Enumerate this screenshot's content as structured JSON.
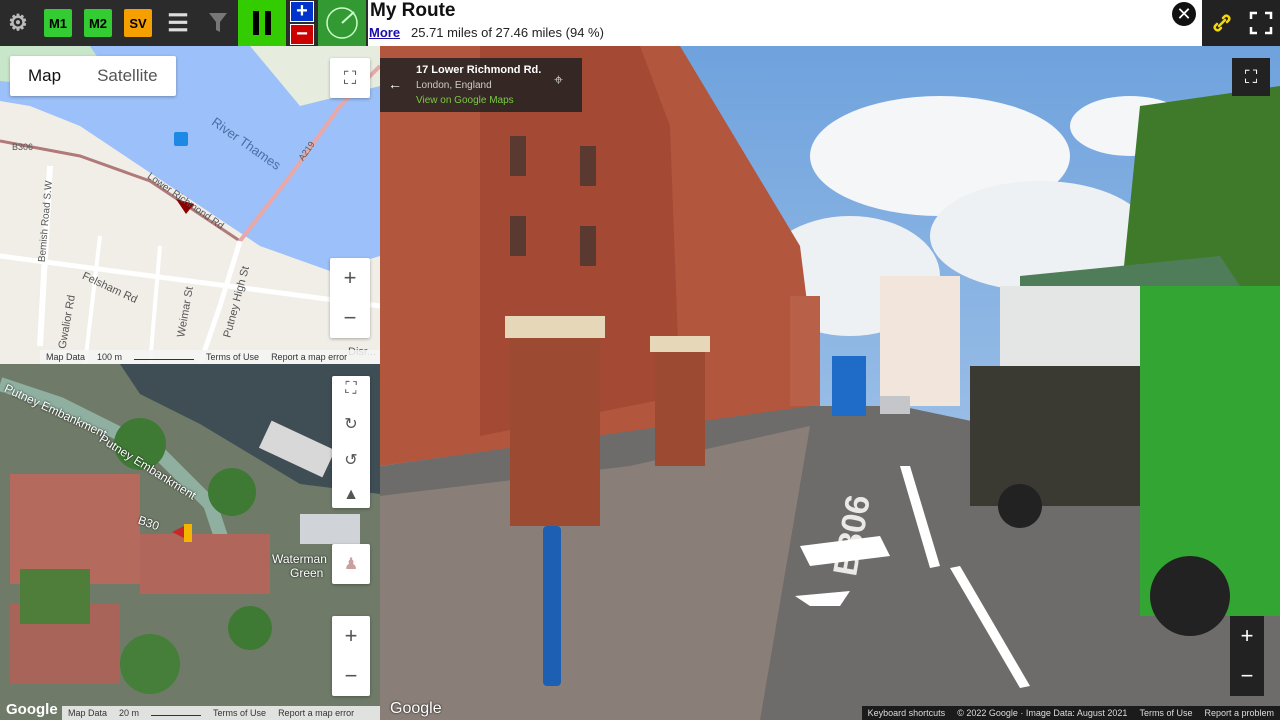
{
  "toolbar": {
    "m1_label": "M1",
    "m2_label": "M2",
    "sv_label": "SV",
    "colors": {
      "m1": "#33cc33",
      "m2": "#33cc33",
      "sv": "#f5a000",
      "pause": "#33cc00",
      "zoom": "#0033cc",
      "zoomout": "#cc0000",
      "compass": "#339933"
    }
  },
  "header": {
    "title": "My Route",
    "more_label": "More",
    "progress_text": "25.71 miles of 27.46 miles (94 %)"
  },
  "roadmap": {
    "tab_map": "Map",
    "tab_satellite": "Satellite",
    "labels": {
      "river": "River Thames",
      "b306": "B306",
      "lower_richmond": "Lower Richmond Rd",
      "a219": "A219",
      "bemish": "Bemish Road S.W",
      "felsham": "Felsham Rd",
      "gwalior": "Gwalior Rd",
      "weimar": "Weimar St",
      "putney_high": "Putney High St",
      "disraeli": "Disr..."
    },
    "footer": {
      "map_data": "Map Data",
      "scale": "100 m",
      "terms": "Terms of Use",
      "report": "Report a map error"
    }
  },
  "satellite": {
    "labels": {
      "embankment1": "Putney Embankment",
      "embankment2": "Putney Embankment",
      "b306": "B30",
      "waterman": "Waterman",
      "green": "Green"
    },
    "footer": {
      "google": "Google",
      "map_data": "Map Data",
      "scale": "20 m",
      "terms": "Terms of Use",
      "report": "Report a map error"
    }
  },
  "streetview": {
    "address_title": "17 Lower Richmond Rd.",
    "address_sub": "London, England",
    "address_link": "View on Google Maps",
    "road_marking": "B306",
    "google": "Google",
    "footer": {
      "shortcuts": "Keyboard shortcuts",
      "copyright": "© 2022 Google · Image Data: August 2021",
      "terms": "Terms of Use",
      "report": "Report a problem"
    }
  }
}
